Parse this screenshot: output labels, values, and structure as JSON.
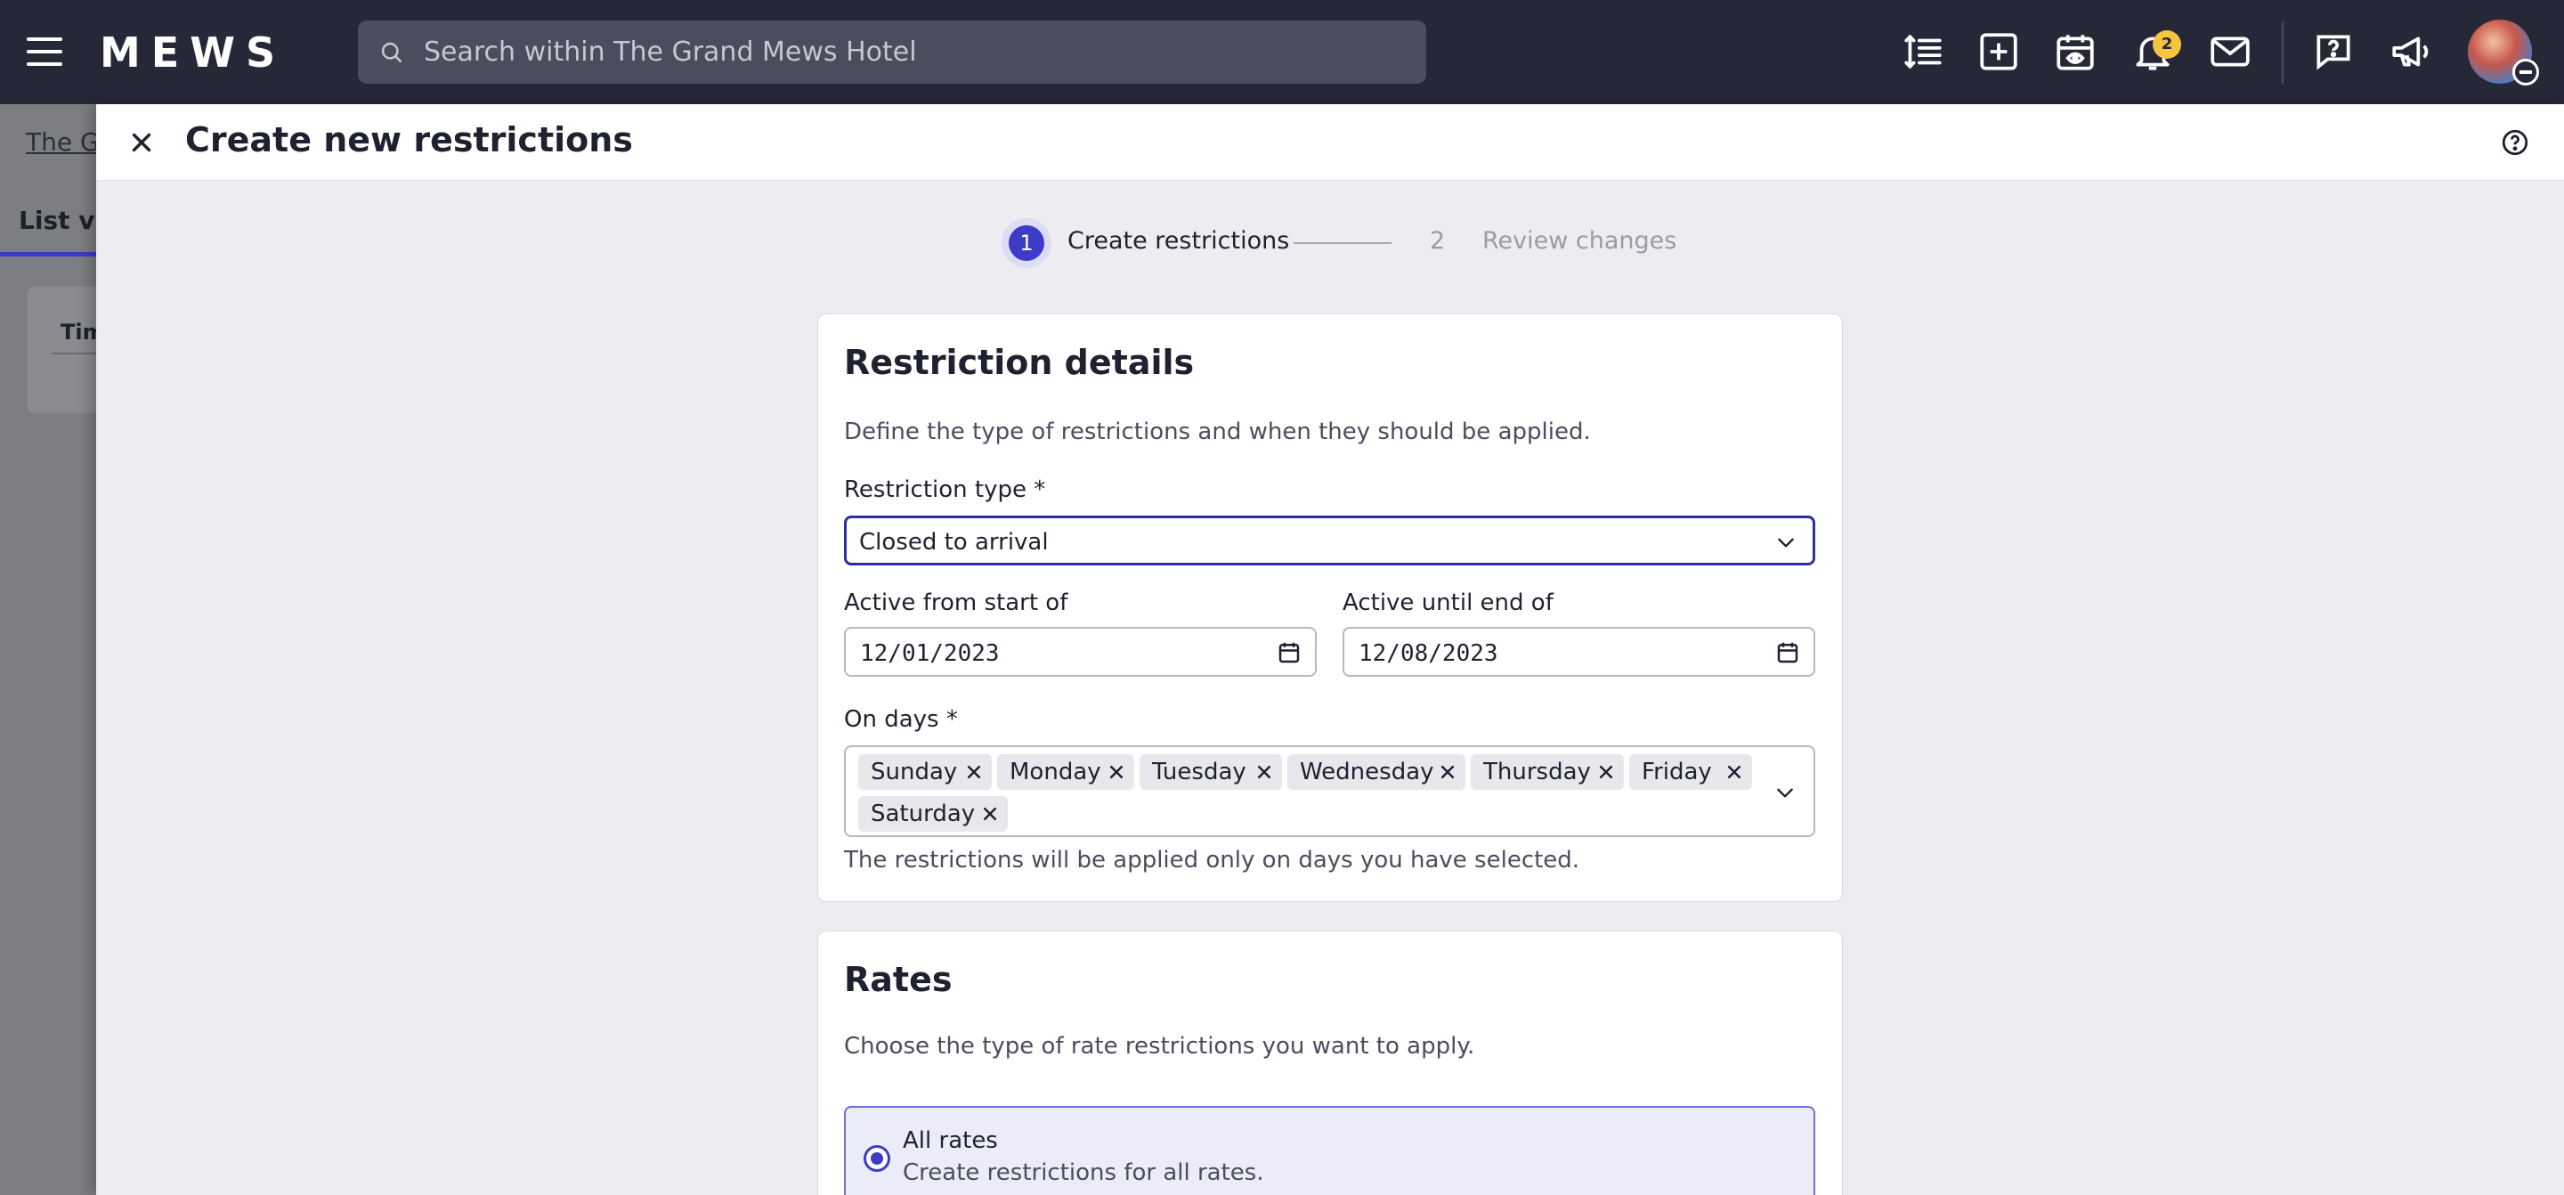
{
  "topbar": {
    "logo": "MEWS",
    "search_placeholder": "Search within The Grand Mews Hotel",
    "notification_count": "2",
    "icons": [
      "hamburger-menu-icon",
      "line-spacing-icon",
      "add-square-icon",
      "calendar-eye-icon",
      "bell-icon",
      "mail-icon",
      "help-chat-icon",
      "megaphone-icon"
    ]
  },
  "background": {
    "breadcrumb": "The Gr",
    "tab": "List vie",
    "card_label": "Tim"
  },
  "panel": {
    "title": "Create new restrictions",
    "stepper": {
      "step1_number": "1",
      "step1_label": "Create restrictions",
      "step2_number": "2",
      "step2_label": "Review changes"
    },
    "details": {
      "title": "Restriction details",
      "description": "Define the type of restrictions and when they should be applied.",
      "restriction_type_label": "Restriction type *",
      "restriction_type_value": "Closed to arrival",
      "active_from_label": "Active from start of",
      "active_from_value": "12/01/2023",
      "active_until_label": "Active until end of",
      "active_until_value": "12/08/2023",
      "on_days_label": "On days *",
      "days": [
        "Sunday",
        "Monday",
        "Tuesday",
        "Wednesday",
        "Thursday",
        "Friday",
        "Saturday"
      ],
      "days_hint": "The restrictions will be applied only on days you have selected."
    },
    "rates": {
      "title": "Rates",
      "description": "Choose the type of rate restrictions you want to apply.",
      "option_title": "All rates",
      "option_desc": "Create restrictions for all rates."
    }
  },
  "colors": {
    "topbar": "#262838",
    "accent": "#3d3cc9",
    "badge": "#f5c441"
  }
}
